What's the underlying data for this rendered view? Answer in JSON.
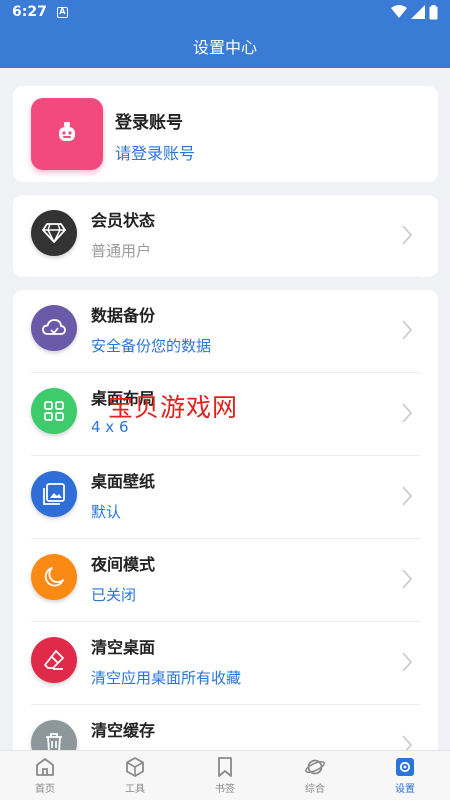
{
  "status_bar": {
    "time": "6:27",
    "indicator": "A"
  },
  "app_bar": {
    "title": "设置中心"
  },
  "login": {
    "title": "登录账号",
    "subtitle": "请登录账号"
  },
  "vip": {
    "title": "会员状态",
    "subtitle": "普通用户"
  },
  "settings": [
    {
      "title": "数据备份",
      "subtitle": "安全备份您的数据",
      "icon": "cloud-icon",
      "color": "#6a5ba8"
    },
    {
      "title": "桌面布局",
      "subtitle": "4 x 6",
      "icon": "grid-icon",
      "color": "#3ecb6c"
    },
    {
      "title": "桌面壁纸",
      "subtitle": "默认",
      "icon": "image-icon",
      "color": "#2f6ed6"
    },
    {
      "title": "夜间模式",
      "subtitle": "已关闭",
      "icon": "moon-icon",
      "color": "#fa8a14"
    },
    {
      "title": "清空桌面",
      "subtitle": "清空应用桌面所有收藏",
      "icon": "eraser-icon",
      "color": "#e02a4a"
    },
    {
      "title": "清空缓存",
      "subtitle": "",
      "icon": "trash-icon",
      "color": "#8e979b"
    }
  ],
  "watermark": "宝贝游戏网",
  "bottom_nav": [
    {
      "label": "首页",
      "icon": "home-icon",
      "active": false
    },
    {
      "label": "工具",
      "icon": "cube-icon",
      "active": false
    },
    {
      "label": "书签",
      "icon": "bookmark-icon",
      "active": false
    },
    {
      "label": "综合",
      "icon": "planet-icon",
      "active": false
    },
    {
      "label": "设置",
      "icon": "settings-icon",
      "active": true
    }
  ],
  "colors": {
    "primary": "#3a7bd5",
    "link": "#2b74d8",
    "login_avatar": "#f2497f",
    "vip_icon": "#333333"
  }
}
